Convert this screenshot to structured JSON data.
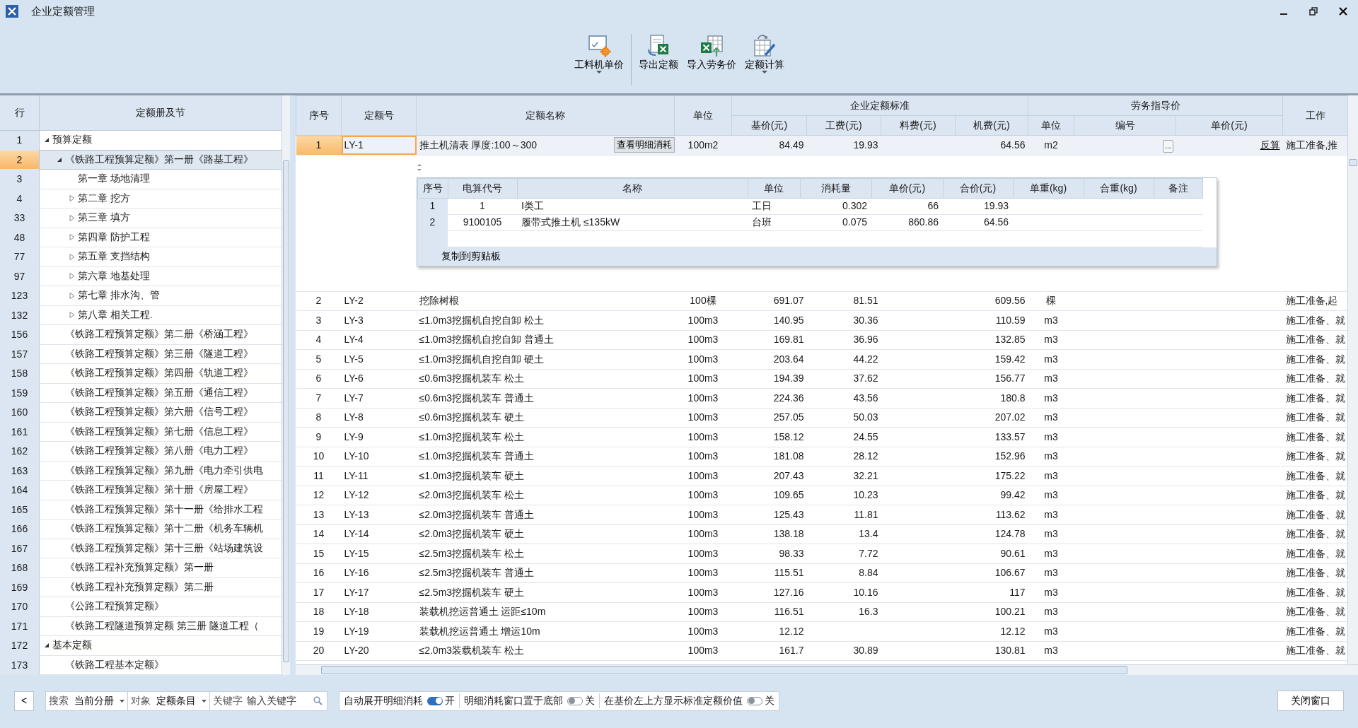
{
  "window": {
    "title": "企业定额管理"
  },
  "toolbar": [
    {
      "label": "工料机单价",
      "kind": "price",
      "dropdown": true
    },
    {
      "label": "导出定额",
      "kind": "export",
      "dropdown": false
    },
    {
      "label": "导入劳务价",
      "kind": "import",
      "dropdown": false
    },
    {
      "label": "定额计算",
      "kind": "calc",
      "dropdown": true
    }
  ],
  "tree_panel": {
    "columns": [
      "行",
      "定额册及节"
    ],
    "tree": [
      {
        "row": "1",
        "label": "预算定额",
        "expanded": true,
        "selected": false,
        "children": [
          {
            "row": "2",
            "label": "《铁路工程预算定额》第一册《路基工程》",
            "expanded": true,
            "selected": true,
            "children": [
              {
                "row": "3",
                "label": "第一章 场地清理",
                "selected": false
              },
              {
                "row": "4",
                "label": "第二章 挖方",
                "expanded": false,
                "selected": false
              },
              {
                "row": "33",
                "label": "第三章 填方",
                "expanded": false,
                "selected": false
              },
              {
                "row": "48",
                "label": "第四章 防护工程",
                "expanded": false,
                "selected": false
              },
              {
                "row": "77",
                "label": "第五章 支挡结构",
                "expanded": false,
                "selected": false
              },
              {
                "row": "97",
                "label": "第六章 地基处理",
                "expanded": false,
                "selected": false
              },
              {
                "row": "123",
                "label": "第七章 排水沟、管",
                "expanded": false,
                "selected": false
              },
              {
                "row": "132",
                "label": "第八章 相关工程.",
                "expanded": false,
                "selected": false
              }
            ]
          },
          {
            "row": "156",
            "label": "《铁路工程预算定额》第二册《桥涵工程》",
            "selected": false
          },
          {
            "row": "157",
            "label": "《铁路工程预算定额》第三册《隧道工程》",
            "selected": false
          },
          {
            "row": "158",
            "label": "《铁路工程预算定额》第四册《轨道工程》",
            "selected": false
          },
          {
            "row": "159",
            "label": "《铁路工程预算定额》第五册《通信工程》",
            "selected": false
          },
          {
            "row": "160",
            "label": "《铁路工程预算定额》第六册《信号工程》",
            "selected": false
          },
          {
            "row": "161",
            "label": "《铁路工程预算定额》第七册《信息工程》",
            "selected": false
          },
          {
            "row": "162",
            "label": "《铁路工程预算定额》第八册《电力工程》",
            "selected": false
          },
          {
            "row": "163",
            "label": "《铁路工程预算定额》第九册《电力牵引供电",
            "selected": false
          },
          {
            "row": "164",
            "label": "《铁路工程预算定额》第十册《房屋工程》",
            "selected": false
          },
          {
            "row": "165",
            "label": "《铁路工程预算定额》第十一册《给排水工程",
            "selected": false
          },
          {
            "row": "166",
            "label": "《铁路工程预算定额》第十二册《机务车辆机",
            "selected": false
          },
          {
            "row": "167",
            "label": "《铁路工程预算定额》第十三册《站场建筑设",
            "selected": false
          },
          {
            "row": "168",
            "label": "《铁路工程补充预算定额》第一册",
            "selected": false
          },
          {
            "row": "169",
            "label": "《铁路工程补充预算定额》第二册",
            "selected": false
          },
          {
            "row": "170",
            "label": "《公路工程预算定额》",
            "selected": false
          },
          {
            "row": "171",
            "label": "《铁路工程隧道预算定额 第三册 隧道工程（",
            "selected": false
          }
        ]
      },
      {
        "row": "172",
        "label": "基本定额",
        "expanded": true,
        "selected": false,
        "children": [
          {
            "row": "173",
            "label": "《铁路工程基本定额》",
            "selected": false
          }
        ]
      }
    ]
  },
  "table": {
    "headers": {
      "seq": "序号",
      "code": "定额号",
      "name": "定额名称",
      "unit": "单位",
      "group_standard": "企业定额标准",
      "base_price": "基价(元)",
      "labor_fee": "工费(元)",
      "material_fee": "料费(元)",
      "machine_fee": "机费(元)",
      "group_labor": "劳务指导价",
      "labor_unit": "单位",
      "labor_code": "编号",
      "labor_price": "单价(元)",
      "work": "工作"
    },
    "rows": [
      {
        "seq": "1",
        "code": "LY-1",
        "name": "推土机清表 厚度:100～300",
        "detail_button": "查看明细消耗",
        "unit": "100m2",
        "base_price": "84.49",
        "labor_fee": "19.93",
        "machine_fee": "64.56",
        "labor_unit": "m2",
        "labor_code_button": "...",
        "reverse_link": "反算",
        "work": "施工准备,推",
        "selected": true
      },
      {
        "seq": "2",
        "code": "LY-2",
        "name": "挖除树根",
        "unit": "100棵",
        "base_price": "691.07",
        "labor_fee": "81.51",
        "machine_fee": "609.56",
        "labor_unit": "棵",
        "work": "施工准备,起",
        "selected": false
      },
      {
        "seq": "3",
        "code": "LY-3",
        "name": "≤1.0m3挖掘机自挖自卸 松土",
        "unit": "100m3",
        "base_price": "140.95",
        "labor_fee": "30.36",
        "machine_fee": "110.59",
        "labor_unit": "m3",
        "work": "施工准备、就",
        "selected": false
      },
      {
        "seq": "4",
        "code": "LY-4",
        "name": "≤1.0m3挖掘机自挖自卸 普通土",
        "unit": "100m3",
        "base_price": "169.81",
        "labor_fee": "36.96",
        "machine_fee": "132.85",
        "labor_unit": "m3",
        "work": "施工准备、就",
        "selected": false
      },
      {
        "seq": "5",
        "code": "LY-5",
        "name": "≤1.0m3挖掘机自挖自卸 硬土",
        "unit": "100m3",
        "base_price": "203.64",
        "labor_fee": "44.22",
        "machine_fee": "159.42",
        "labor_unit": "m3",
        "work": "施工准备、就",
        "selected": false
      },
      {
        "seq": "6",
        "code": "LY-6",
        "name": "≤0.6m3挖掘机装车 松土",
        "unit": "100m3",
        "base_price": "194.39",
        "labor_fee": "37.62",
        "machine_fee": "156.77",
        "labor_unit": "m3",
        "work": "施工准备、就",
        "selected": false
      },
      {
        "seq": "7",
        "code": "LY-7",
        "name": "≤0.6m3挖掘机装车 普通土",
        "unit": "100m3",
        "base_price": "224.36",
        "labor_fee": "43.56",
        "machine_fee": "180.8",
        "labor_unit": "m3",
        "work": "施工准备、就",
        "selected": false
      },
      {
        "seq": "8",
        "code": "LY-8",
        "name": "≤0.6m3挖掘机装车 硬土",
        "unit": "100m3",
        "base_price": "257.05",
        "labor_fee": "50.03",
        "machine_fee": "207.02",
        "labor_unit": "m3",
        "work": "施工准备、就",
        "selected": false
      },
      {
        "seq": "9",
        "code": "LY-9",
        "name": "≤1.0m3挖掘机装车 松土",
        "unit": "100m3",
        "base_price": "158.12",
        "labor_fee": "24.55",
        "machine_fee": "133.57",
        "labor_unit": "m3",
        "work": "施工准备、就",
        "selected": false
      },
      {
        "seq": "10",
        "code": "LY-10",
        "name": "≤1.0m3挖掘机装车 普通土",
        "unit": "100m3",
        "base_price": "181.08",
        "labor_fee": "28.12",
        "machine_fee": "152.96",
        "labor_unit": "m3",
        "work": "施工准备、就",
        "selected": false
      },
      {
        "seq": "11",
        "code": "LY-11",
        "name": "≤1.0m3挖掘机装车 硬土",
        "unit": "100m3",
        "base_price": "207.43",
        "labor_fee": "32.21",
        "machine_fee": "175.22",
        "labor_unit": "m3",
        "work": "施工准备、就",
        "selected": false
      },
      {
        "seq": "12",
        "code": "LY-12",
        "name": "≤2.0m3挖掘机装车 松土",
        "unit": "100m3",
        "base_price": "109.65",
        "labor_fee": "10.23",
        "machine_fee": "99.42",
        "labor_unit": "m3",
        "work": "施工准备、就",
        "selected": false
      },
      {
        "seq": "13",
        "code": "LY-13",
        "name": "≤2.0m3挖掘机装车 普通土",
        "unit": "100m3",
        "base_price": "125.43",
        "labor_fee": "11.81",
        "machine_fee": "113.62",
        "labor_unit": "m3",
        "work": "施工准备、就",
        "selected": false
      },
      {
        "seq": "14",
        "code": "LY-14",
        "name": "≤2.0m3挖掘机装车 硬土",
        "unit": "100m3",
        "base_price": "138.18",
        "labor_fee": "13.4",
        "machine_fee": "124.78",
        "labor_unit": "m3",
        "work": "施工准备、就",
        "selected": false
      },
      {
        "seq": "15",
        "code": "LY-15",
        "name": "≤2.5m3挖掘机装车 松土",
        "unit": "100m3",
        "base_price": "98.33",
        "labor_fee": "7.72",
        "machine_fee": "90.61",
        "labor_unit": "m3",
        "work": "施工准备、就",
        "selected": false
      },
      {
        "seq": "16",
        "code": "LY-16",
        "name": "≤2.5m3挖掘机装车 普通土",
        "unit": "100m3",
        "base_price": "115.51",
        "labor_fee": "8.84",
        "machine_fee": "106.67",
        "labor_unit": "m3",
        "work": "施工准备、就",
        "selected": false
      },
      {
        "seq": "17",
        "code": "LY-17",
        "name": "≤2.5m3挖掘机装车 硬土",
        "unit": "100m3",
        "base_price": "127.16",
        "labor_fee": "10.16",
        "machine_fee": "117",
        "labor_unit": "m3",
        "work": "施工准备、就",
        "selected": false
      },
      {
        "seq": "18",
        "code": "LY-18",
        "name": "装载机挖运普通土 运距≤10m",
        "unit": "100m3",
        "base_price": "116.51",
        "labor_fee": "16.3",
        "machine_fee": "100.21",
        "labor_unit": "m3",
        "work": "施工准备、就",
        "selected": false
      },
      {
        "seq": "19",
        "code": "LY-19",
        "name": "装载机挖运普通土 增运10m",
        "unit": "100m3",
        "base_price": "12.12",
        "machine_fee": "12.12",
        "labor_unit": "m3",
        "work": "施工准备、就",
        "selected": false
      },
      {
        "seq": "20",
        "code": "LY-20",
        "name": "≤2.0m3装载机装车 松土",
        "unit": "100m3",
        "base_price": "161.7",
        "labor_fee": "30.89",
        "machine_fee": "130.81",
        "labor_unit": "m3",
        "work": "施工准备、就",
        "selected": false
      }
    ]
  },
  "detail": {
    "columns": [
      "序号",
      "电算代号",
      "名称",
      "单位",
      "消耗量",
      "单价(元)",
      "合价(元)",
      "单重(kg)",
      "合重(kg)",
      "备注"
    ],
    "rows": [
      [
        "1",
        "1",
        "Ⅰ类工",
        "工日",
        "0.302",
        "66",
        "19.93"
      ],
      [
        "2",
        "9100105",
        "履带式推土机 ≤135kW",
        "台班",
        "0.075",
        "860.86",
        "64.56"
      ]
    ],
    "copy_button": "复制到剪贴板"
  },
  "bottom_bar": {
    "back_button": "<",
    "scope": {
      "label": "搜索",
      "value": "当前分册"
    },
    "object": {
      "label": "对象",
      "value": "定额条目"
    },
    "keyword": {
      "label": "关键字",
      "placeholder": "输入关键字"
    },
    "toggles": [
      {
        "label": "自动展开明细消耗",
        "on": true,
        "state_text": "开"
      },
      {
        "label": "明细消耗窗口置于底部",
        "on": false,
        "state_text": "关"
      },
      {
        "label": "在基价左上方显示标准定额价值",
        "on": false,
        "state_text": "关"
      }
    ],
    "close_button": "关闭窗口"
  }
}
